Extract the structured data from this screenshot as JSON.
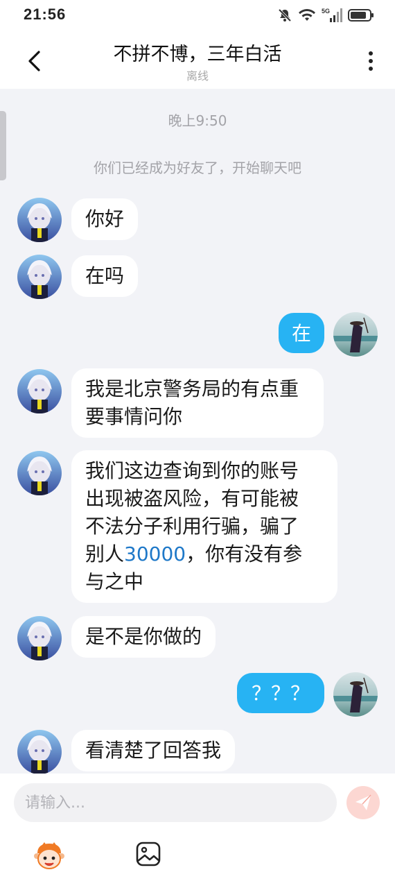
{
  "status_bar": {
    "time": "21:56",
    "icons": [
      "mute-icon",
      "wifi-icon",
      "5g-signal-icon",
      "battery-icon"
    ],
    "network_label": "5G"
  },
  "header": {
    "title": "不拼不博，三年白活",
    "subtitle": "离线",
    "icons": [
      "back-arrow-icon",
      "more-vertical-icon"
    ]
  },
  "chat": {
    "timestamp": "晚上9:50",
    "system_message": "你们已经成为好友了，开始聊天吧",
    "messages": [
      {
        "from": "other",
        "text": "你好"
      },
      {
        "from": "other",
        "text": "在吗"
      },
      {
        "from": "me",
        "text": "在"
      },
      {
        "from": "other",
        "text": "我是北京警务局的有点重要事情问你",
        "lines": [
          "我是北京警务局的有点重",
          "要事情问你"
        ]
      },
      {
        "from": "other",
        "text": "我们这边查询到你的账号出现被盗风险，有可能被不法分子利用行骗，骗了别人30000，你有没有参与之中",
        "lines": [
          "我们这边查询到你的账号",
          "出现被盗风险，有可能被",
          "不法分子利用行骗，骗了"
        ],
        "line4_prefix": "别人",
        "line4_highlight": "30000",
        "line4_suffix": "，你有没有参",
        "line5": "与之中"
      },
      {
        "from": "other",
        "text": "是不是你做的"
      },
      {
        "from": "me",
        "text": "？？？"
      },
      {
        "from": "other",
        "text": "看清楚了回答我"
      }
    ]
  },
  "input_bar": {
    "placeholder": "请输入...",
    "value": "",
    "icons": [
      "send-icon",
      "emoji-mascot-icon",
      "image-icon"
    ]
  },
  "colors": {
    "my_bubble": "#27b3f3",
    "other_bubble": "#ffffff",
    "background": "#f2f3f7",
    "highlight_number": "#1e78c8",
    "send_button": "#fcd7d2"
  }
}
